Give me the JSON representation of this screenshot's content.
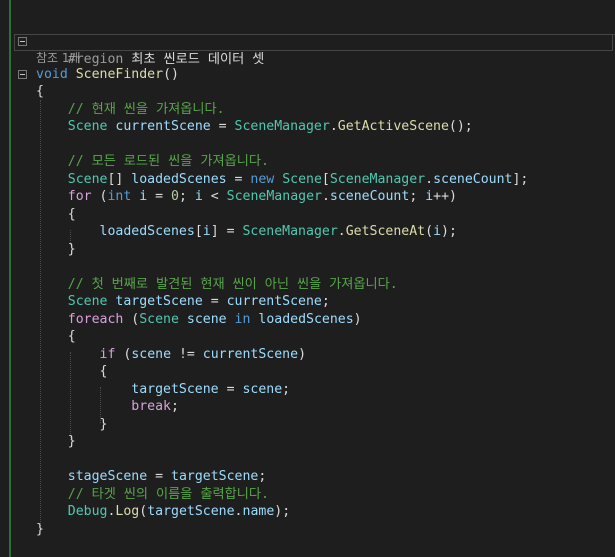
{
  "region": {
    "directive": "#region",
    "title": "최초 씬로드 데이터 셋"
  },
  "codelens": "참조 1개",
  "lines": [
    {
      "t": "void SceneFinder()"
    },
    {
      "t": "{"
    },
    {
      "t": "    // 현재 씬을 가져옵니다."
    },
    {
      "t": "    Scene currentScene = SceneManager.GetActiveScene();"
    },
    {
      "t": ""
    },
    {
      "t": "    // 모든 로드된 씬을 가져옵니다."
    },
    {
      "t": "    Scene[] loadedScenes = new Scene[SceneManager.sceneCount];"
    },
    {
      "t": "    for (int i = 0; i < SceneManager.sceneCount; i++)"
    },
    {
      "t": "    {"
    },
    {
      "t": "        loadedScenes[i] = SceneManager.GetSceneAt(i);"
    },
    {
      "t": "    }"
    },
    {
      "t": ""
    },
    {
      "t": "    // 첫 번째로 발견된 현재 씬이 아닌 씬을 가져옵니다."
    },
    {
      "t": "    Scene targetScene = currentScene;"
    },
    {
      "t": "    foreach (Scene scene in loadedScenes)"
    },
    {
      "t": "    {"
    },
    {
      "t": "        if (scene != currentScene)"
    },
    {
      "t": "        {"
    },
    {
      "t": "            targetScene = scene;"
    },
    {
      "t": "            break;"
    },
    {
      "t": "        }"
    },
    {
      "t": "    }"
    },
    {
      "t": ""
    },
    {
      "t": "    stageScene = targetScene;"
    },
    {
      "t": "    // 타겟 씬의 이름을 출력합니다."
    },
    {
      "t": "    Debug.Log(targetScene.name);"
    },
    {
      "t": "}"
    }
  ]
}
